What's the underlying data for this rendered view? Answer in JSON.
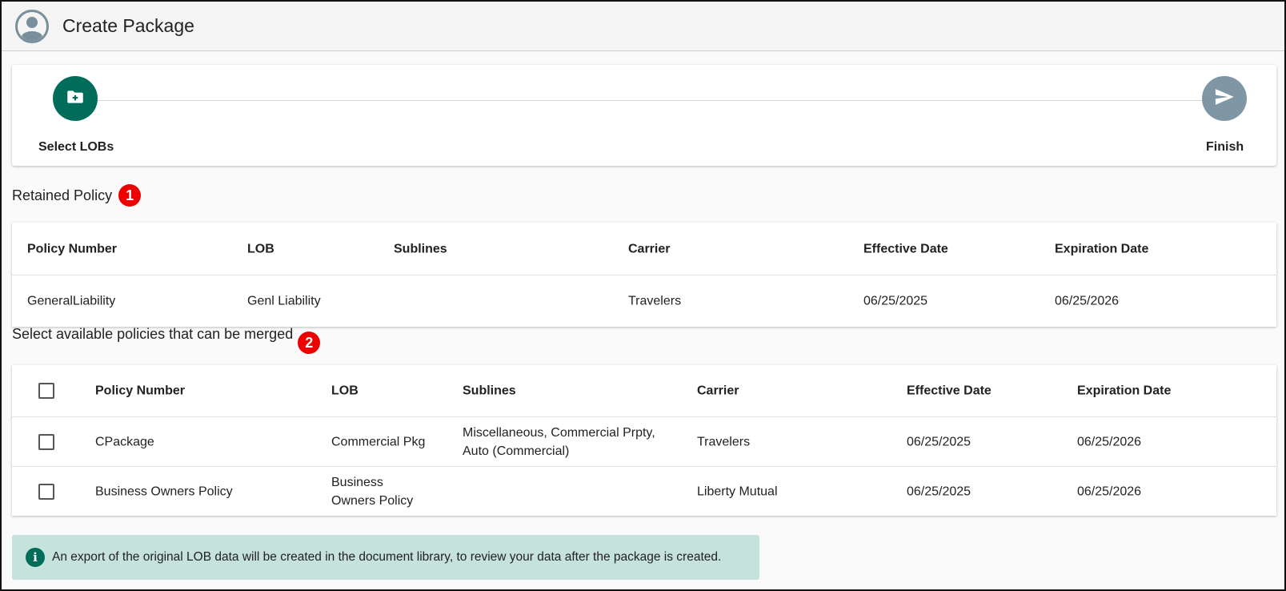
{
  "header": {
    "title": "Create Package",
    "avatar_icon": "account-circle-icon"
  },
  "stepper": {
    "steps": [
      {
        "label": "Select LOBs",
        "icon": "create-new-folder-icon",
        "state": "active"
      },
      {
        "label": "Finish",
        "icon": "send-icon",
        "state": "inactive"
      }
    ]
  },
  "retained": {
    "label": "Retained Policy",
    "badge": "1",
    "columns": [
      "Policy Number",
      "LOB",
      "Sublines",
      "Carrier",
      "Effective Date",
      "Expiration Date"
    ],
    "rows": [
      {
        "policy_number": "GeneralLiability",
        "lob": "Genl Liability",
        "sublines": "",
        "carrier": "Travelers",
        "effective": "06/25/2025",
        "expiration": "06/25/2026"
      }
    ]
  },
  "available": {
    "label": "Select available policies that can be merged",
    "badge": "2",
    "columns": [
      "Policy Number",
      "LOB",
      "Sublines",
      "Carrier",
      "Effective Date",
      "Expiration Date"
    ],
    "rows": [
      {
        "policy_number": "CPackage",
        "lob": "Commercial Pkg",
        "sublines_1": "Miscellaneous, Commercial Prpty,",
        "sublines_2": "Auto (Commercial)",
        "carrier": "Travelers",
        "effective": "06/25/2025",
        "expiration": "06/25/2026",
        "checked": false
      },
      {
        "policy_number": "Business Owners Policy",
        "lob_1": "Business",
        "lob_2": "Owners Policy",
        "sublines": "",
        "carrier": "Liberty Mutual",
        "effective": "06/25/2025",
        "expiration": "06/25/2026",
        "checked": false
      }
    ]
  },
  "info": {
    "icon": "info-icon",
    "glyph": "i",
    "text": "An export of the original LOB data will be created in the document library, to review your data after the package is created."
  },
  "colors": {
    "accent": "#006d5b",
    "inactive_step": "#7f96a4",
    "badge": "#ee0000",
    "info_bg": "#c6e2dc"
  }
}
